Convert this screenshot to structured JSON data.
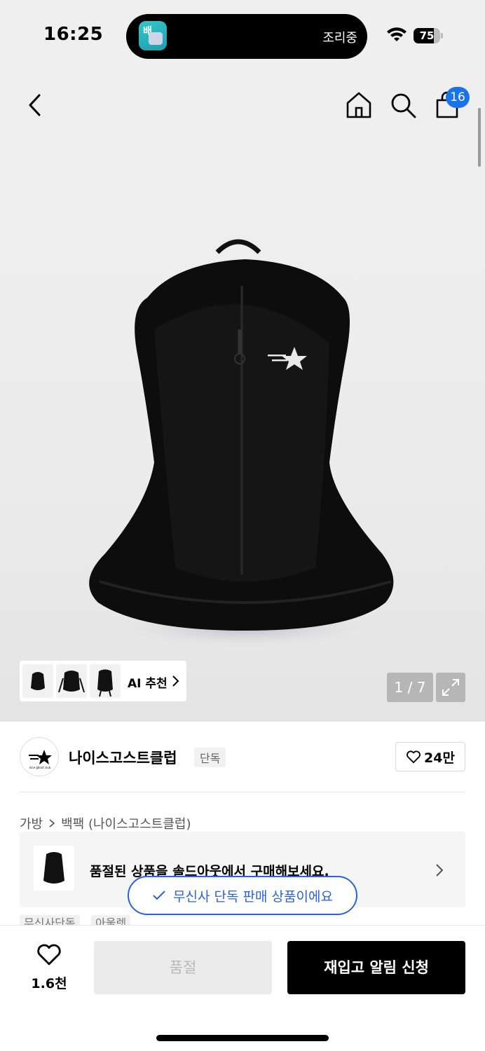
{
  "status_bar": {
    "time": "16:25",
    "island_app_glyph": "배",
    "island_status": "조리중",
    "battery": "75",
    "battery_level": 0.75
  },
  "header": {
    "cart_count": "16"
  },
  "gallery": {
    "ai_label": "AI 추천",
    "page_indicator": "1 / 7"
  },
  "brand": {
    "logo_text": "nice ghost club",
    "name": "나이스고스트클럽",
    "exclusive_tag": "단독",
    "like_count": "24만"
  },
  "breadcrumb": {
    "items": [
      "가방",
      "백팩 (나이스고스트클럽)"
    ]
  },
  "soldout_banner": {
    "text": "품절된 상품을 솔드아웃에서 구매해보세요."
  },
  "toast": {
    "text": "무신사 단독 판매 상품이에요"
  },
  "tags": [
    "무신사단독",
    "아울렛"
  ],
  "bottom_bar": {
    "wish_count": "1.6천",
    "soldout_label": "품절",
    "restock_label": "재입고 알림 신청"
  },
  "colors": {
    "accent_blue": "#2a62d9",
    "badge_blue": "#1a73e8",
    "primary_button": "#000000"
  }
}
